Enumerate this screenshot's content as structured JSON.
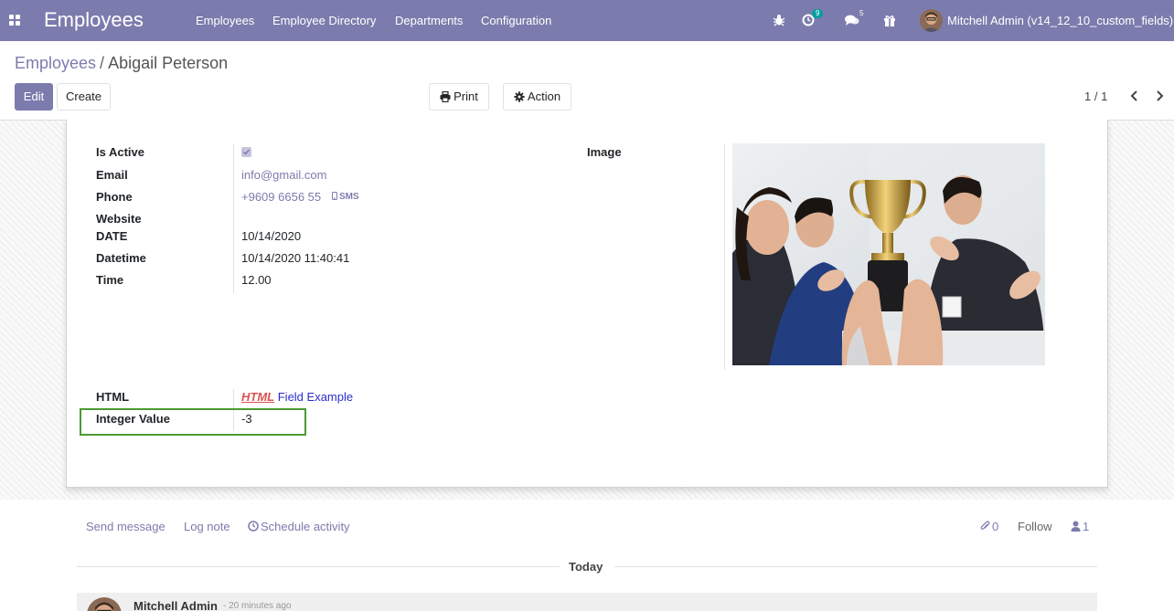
{
  "app": {
    "title": "Employees"
  },
  "nav": {
    "menu": [
      "Employees",
      "Employee Directory",
      "Departments",
      "Configuration"
    ],
    "activity_count": "9",
    "message_count": "5",
    "user": "Mitchell Admin (v14_12_10_custom_fields)"
  },
  "breadcrumb": {
    "parent": "Employees",
    "separator": "/",
    "current": "Abigail Peterson"
  },
  "toolbar": {
    "edit": "Edit",
    "create": "Create",
    "print": "Print",
    "action": "Action"
  },
  "pager": {
    "text": "1 / 1"
  },
  "form": {
    "is_active": {
      "label": "Is Active",
      "checked": true
    },
    "email": {
      "label": "Email",
      "value": "info@gmail.com"
    },
    "phone": {
      "label": "Phone",
      "value": "+9609 6656 55",
      "sms": "SMS"
    },
    "website": {
      "label": "Website",
      "value": ""
    },
    "date": {
      "label": "DATE",
      "value": "10/14/2020"
    },
    "datetime": {
      "label": "Datetime",
      "value": "10/14/2020 11:40:41"
    },
    "time": {
      "label": "Time",
      "value": "12.00"
    },
    "image": {
      "label": "Image"
    },
    "html": {
      "label": "HTML",
      "emphasis": "HTML",
      "rest": "Field Example"
    },
    "integer": {
      "label": "Integer Value",
      "value": "-3"
    }
  },
  "chatter": {
    "send_message": "Send message",
    "log_note": "Log note",
    "schedule_activity": "Schedule activity",
    "attachments": "0",
    "follow": "Follow",
    "followers": "1",
    "today": "Today",
    "message": {
      "author": "Mitchell Admin",
      "time": "- 20 minutes ago"
    }
  },
  "colors": {
    "brand": "#7c7bad",
    "highlight": "#4a9a32",
    "badge": "#00a09d"
  }
}
